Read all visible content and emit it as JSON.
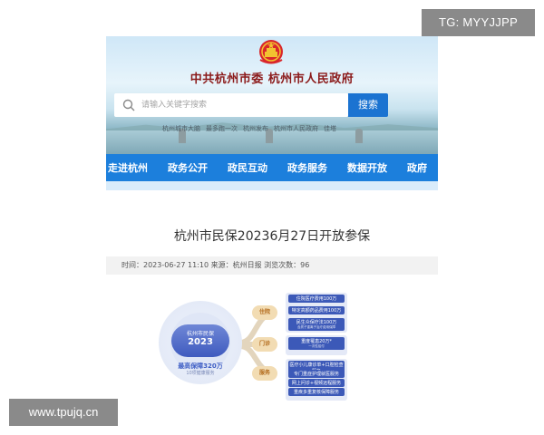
{
  "watermarks": {
    "top_right": "TG: MYYJJPP",
    "bottom_left": "www.tpujq.cn"
  },
  "header": {
    "title": "中共杭州市委   杭州市人民政府",
    "search_placeholder": "请输入关键字搜索",
    "search_button": "搜索",
    "quick_links": [
      "杭州城市大脑",
      "最多跑一次",
      "杭州发布",
      "杭州市人民政府",
      "佳塔"
    ]
  },
  "nav": {
    "items": [
      "走进杭州",
      "政务公开",
      "政民互动",
      "政务服务",
      "数据开放",
      "政府"
    ]
  },
  "article": {
    "title": "杭州市民保20236月27日开放参保",
    "meta": "时间：2023-06-27 11:10 来源：杭州日报 浏览次数：96"
  },
  "infographic": {
    "pill_line1": "杭州市民保",
    "pill_line2": "2023",
    "caption1": "最高保障320万",
    "caption2": "10项健康服务",
    "categories": [
      "住院",
      "门诊",
      "服务"
    ],
    "boxes_top": [
      {
        "label": "住院医疗费用100万",
        "sub": ""
      },
      {
        "label": "特定高额药品费用100万",
        "sub": ""
      },
      {
        "label": "民生众保疗法100万",
        "sub": "含质子重离子治疗费用保障"
      }
    ],
    "boxes_mid": [
      {
        "label": "重度罹患20万*",
        "sub": "一次性给付"
      }
    ],
    "boxes_bottom": [
      "医疗小儿康诊单+口腔检查服务",
      "专门重症护理就医服务",
      "网上问诊+视频远程服务",
      "重疾多重复核保障服务"
    ],
    "colors": {
      "primary": "#3c59b8",
      "accent": "#f2dcb3",
      "accent_text": "#b26a1b"
    }
  },
  "colors": {
    "nav_bg": "#1c7fdc",
    "search_button_bg": "#1b73d1",
    "title_red": "#8b1a1a"
  }
}
